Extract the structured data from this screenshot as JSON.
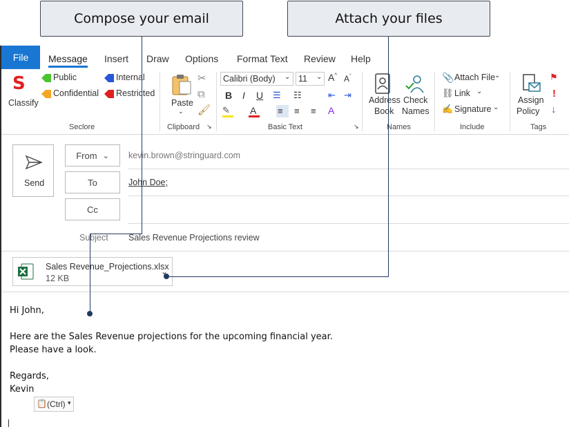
{
  "callouts": {
    "compose": "Compose your email",
    "attach": "Attach your files"
  },
  "tabs": [
    "File",
    "Message",
    "Insert",
    "Draw",
    "Options",
    "Format Text",
    "Review",
    "Help"
  ],
  "ribbon": {
    "seclore": {
      "classify": "Classify",
      "public": "Public",
      "internal": "Internal",
      "confidential": "Confidential",
      "restricted": "Restricted",
      "label": "Seclore"
    },
    "clipboard": {
      "paste": "Paste",
      "label": "Clipboard"
    },
    "basic_text": {
      "font": "Calibri (Body)",
      "size": "11",
      "bold": "B",
      "italic": "I",
      "underline": "U",
      "label": "Basic Text"
    },
    "names": {
      "address_book": [
        "Address",
        "Book"
      ],
      "check_names": [
        "Check",
        "Names"
      ],
      "label": "Names"
    },
    "include": {
      "attach_file": "Attach File",
      "link": "Link",
      "signature": "Signature",
      "label": "Include"
    },
    "tags": {
      "assign_policy": [
        "Assign",
        "Policy"
      ],
      "label": "Tags"
    }
  },
  "compose": {
    "send": "Send",
    "from_label": "From",
    "from_value": "kevin.brown@stringuard.com",
    "to_label": "To",
    "to_value": "John Doe;",
    "cc_label": "Cc",
    "subject_label": "Subject",
    "subject_value": "Sales Revenue Projections review"
  },
  "attachment": {
    "name": "Sales Revenue_Projections.xlsx",
    "size": "12 KB"
  },
  "body": {
    "greeting": "Hi John,",
    "line1": "Here are the Sales Revenue projections for the upcoming financial year.",
    "line2": "Please have a look.",
    "closing": "Regards,",
    "signature": "Kevin"
  },
  "paste_options": "(Ctrl)",
  "colors": {
    "accent": "#1976d2",
    "seclore_red": "#e02020",
    "excel_green": "#1d6f42",
    "connector": "#1f3a5f"
  }
}
